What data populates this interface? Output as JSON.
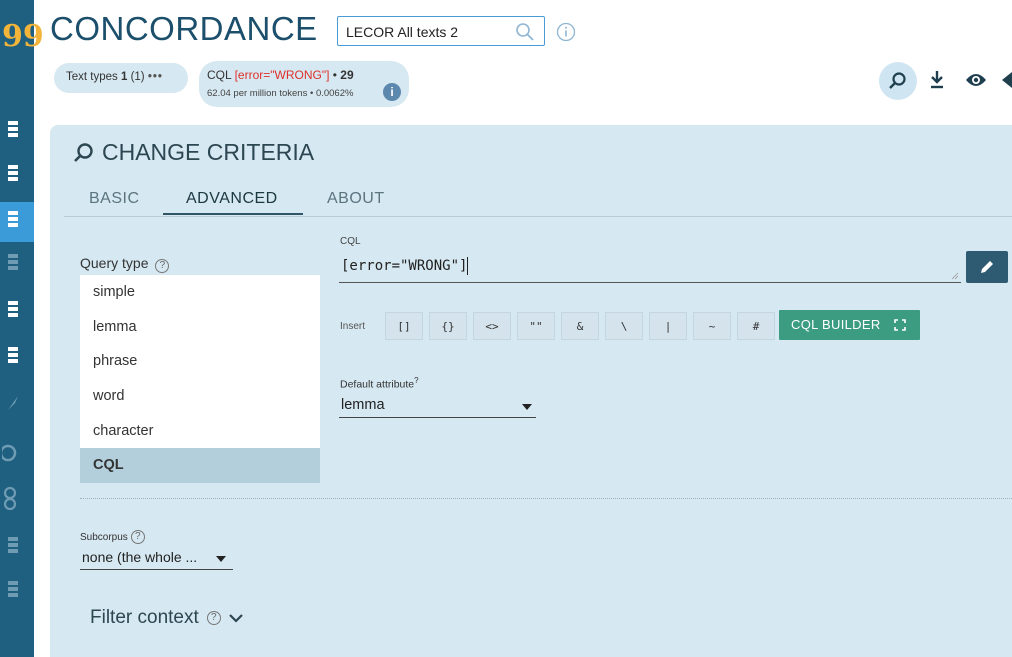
{
  "app": {
    "title": "CONCORDANCE"
  },
  "corpus": {
    "value": "LECOR All texts 2"
  },
  "chips": {
    "text_types": {
      "label": "Text types ",
      "count": "1",
      "count_paren": " (1)",
      "more": "•••"
    },
    "cql": {
      "prefix": "CQL ",
      "query": "[error=\"WRONG\"]",
      "sep": " • ",
      "hits": "29",
      "stats": "62.04 per million tokens • 0.0062%",
      "info_glyph": "i"
    }
  },
  "toolbar": {
    "icons": [
      "search-icon",
      "download-icon",
      "view-icon",
      "more-icon"
    ]
  },
  "panel": {
    "title": "CHANGE CRITERIA",
    "tabs": [
      {
        "label": "BASIC",
        "active": false
      },
      {
        "label": "ADVANCED",
        "active": true
      },
      {
        "label": "ABOUT",
        "active": false
      }
    ]
  },
  "query_type": {
    "label": "Query type",
    "options": [
      "simple",
      "lemma",
      "phrase",
      "word",
      "character",
      "CQL"
    ],
    "selected": "CQL"
  },
  "cql": {
    "label": "CQL",
    "value": "[error=\"WRONG\"]",
    "insert_label": "Insert",
    "insert_buttons": [
      "[]",
      "{}",
      "<>",
      "\"\"",
      "&",
      "\\",
      "|",
      "~",
      "#"
    ],
    "builder_label": "CQL BUILDER"
  },
  "default_attribute": {
    "label": "Default attribute",
    "sup": "?",
    "value": "lemma"
  },
  "subcorpus": {
    "label": "Subcorpus",
    "value": "none (the whole ..."
  },
  "filter_context": {
    "label": "Filter context"
  },
  "help_glyph": "?",
  "colors": {
    "sidebar": "#1f5f80",
    "sidebar_active": "#3a9bd8",
    "panel_bg": "#d6e8f1",
    "query_red": "#e0302a",
    "builder_green": "#3b9c82",
    "edit_button": "#2f5b72"
  }
}
